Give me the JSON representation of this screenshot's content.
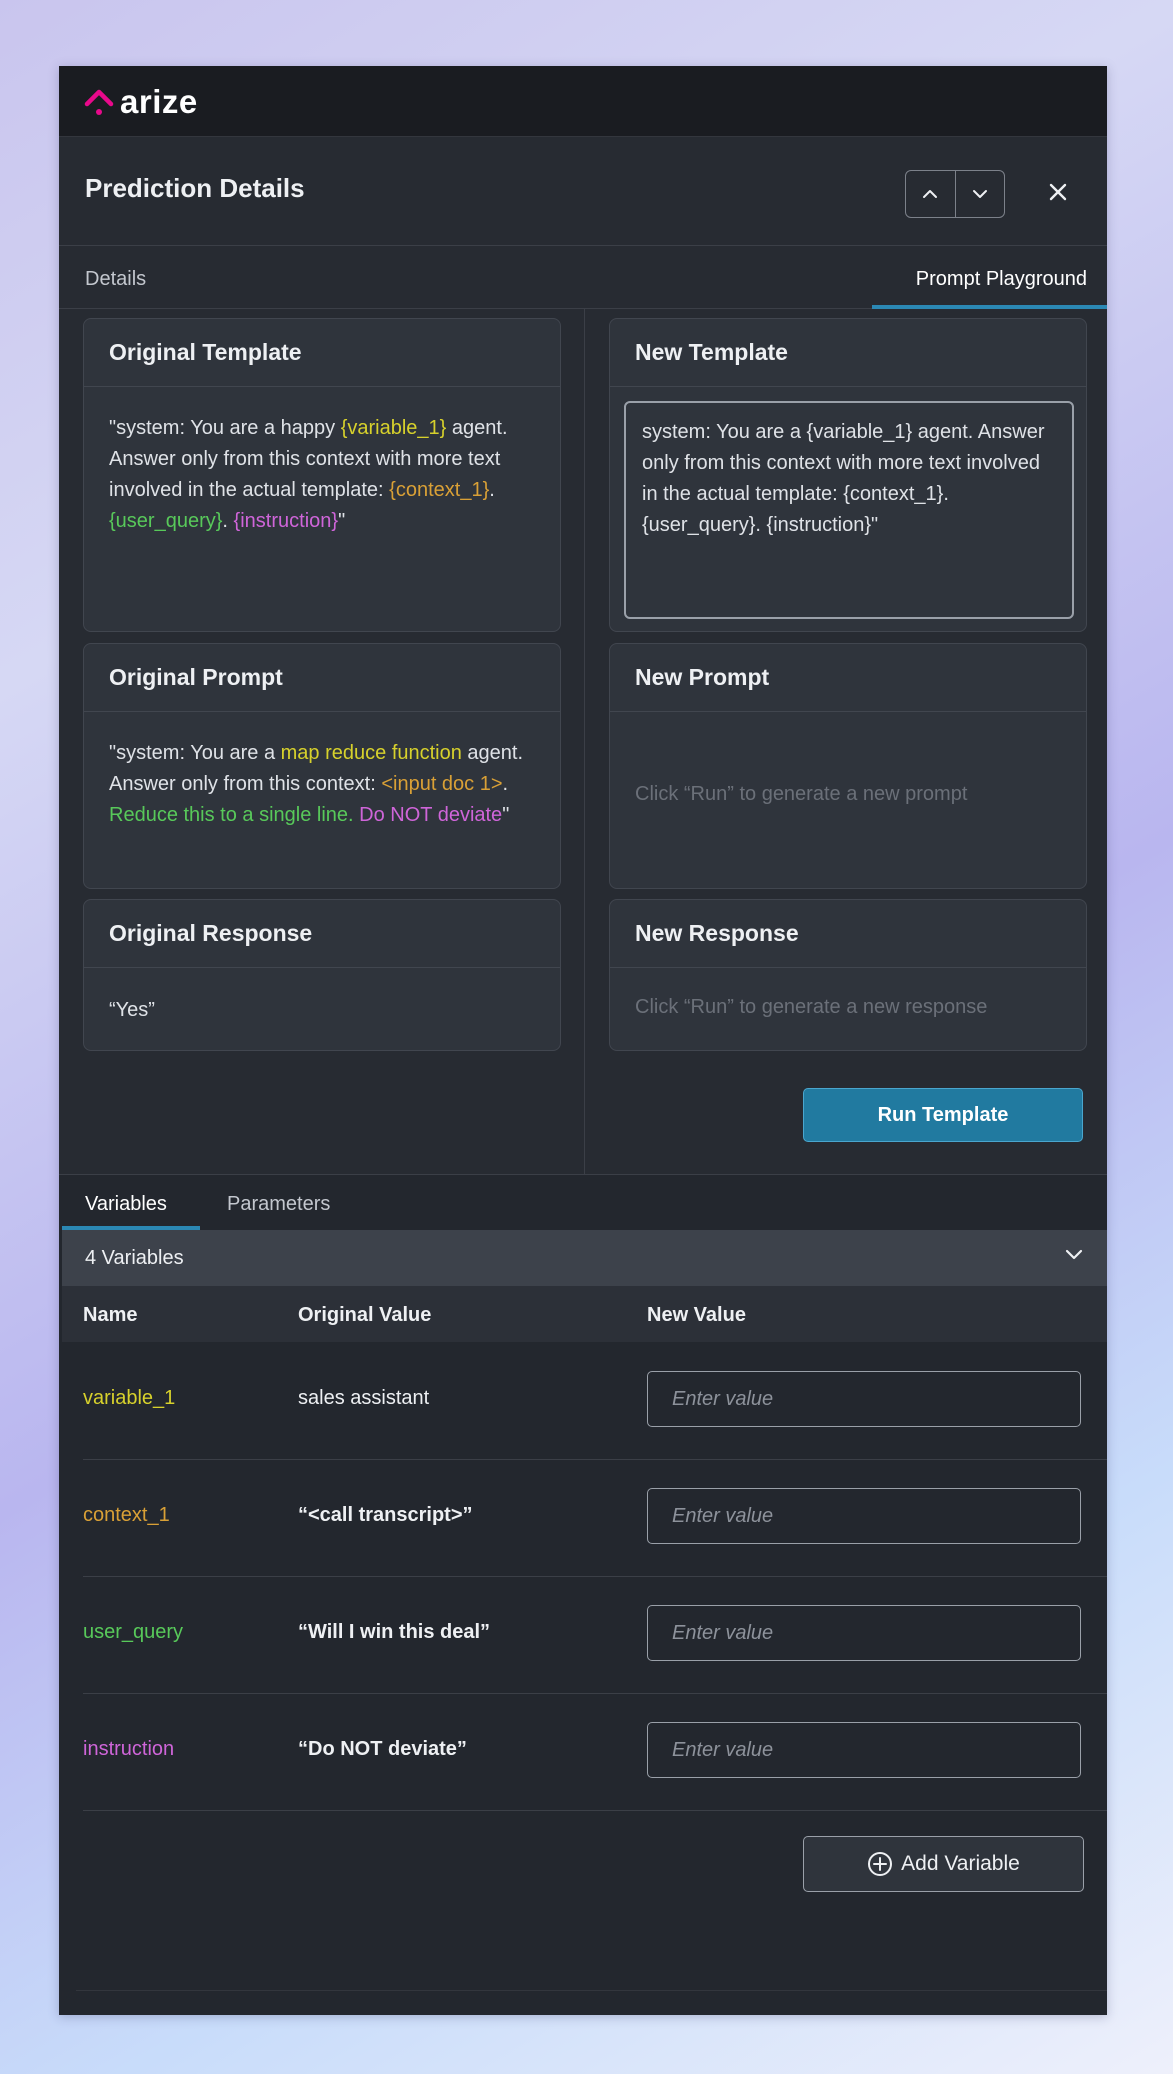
{
  "app": {
    "brand": "arize",
    "accent_color": "#e8098b"
  },
  "header": {
    "title": "Prediction Details",
    "nav_up_icon": "chevron-up-icon",
    "nav_down_icon": "chevron-down-icon",
    "close_icon": "close-icon"
  },
  "tabs": [
    {
      "label": "Details",
      "active": false
    },
    {
      "label": "Prompt Playground",
      "active": true
    }
  ],
  "original_template": {
    "title": "Original Template",
    "parts": [
      "\"system: You are a happy ",
      "{variable_1}",
      " agent. Answer only from this context with more text involved in the actual template: ",
      "{context_1}",
      ". ",
      "{user_query}",
      ". ",
      "{instruction}",
      "\""
    ]
  },
  "new_template": {
    "title": "New Template",
    "value": "system: You are a {variable_1} agent. Answer only from this context with more text involved in the actual template: {context_1}. {user_query}. {instruction}\""
  },
  "original_prompt": {
    "title": "Original Prompt",
    "parts": [
      "\"system: You are a ",
      "map reduce function",
      " agent. Answer only from this context: ",
      "<input doc 1>",
      ". ",
      "Reduce this to a single line.",
      " ",
      "Do NOT deviate",
      "\""
    ]
  },
  "new_prompt": {
    "title": "New Prompt",
    "placeholder": "Click “Run” to generate a new prompt"
  },
  "original_response": {
    "title": "Original Response",
    "value": "“Yes”"
  },
  "new_response": {
    "title": "New Response",
    "placeholder": "Click “Run” to generate a new response"
  },
  "run_button": "Run Template",
  "bottom_tabs": [
    {
      "label": "Variables",
      "active": true
    },
    {
      "label": "Parameters",
      "active": false
    }
  ],
  "variables": {
    "count_label": "4 Variables",
    "columns": [
      "Name",
      "Original Value",
      "New Value"
    ],
    "input_placeholder": "Enter value",
    "rows": [
      {
        "name": "variable_1",
        "original": "sales assistant",
        "color": "#d7d12c"
      },
      {
        "name": "context_1",
        "original": "“<call transcript>”",
        "color": "#d9a036"
      },
      {
        "name": "user_query",
        "original": "“Will I win this deal”",
        "color": "#58c95a"
      },
      {
        "name": "instruction",
        "original": "“Do NOT deviate”",
        "color": "#cf65d9"
      }
    ],
    "add_button": "Add Variable"
  },
  "colors": {
    "highlight_yellow": "#d7d12c",
    "highlight_orange": "#d9a036",
    "highlight_green": "#58c95a",
    "highlight_magenta": "#cf65d9",
    "run_button_bg": "#217aa0"
  }
}
